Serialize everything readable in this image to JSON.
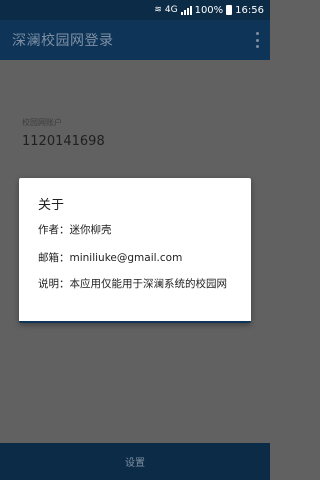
{
  "status_bar": {
    "network": "4G",
    "battery": "100%",
    "time": "16:56",
    "icons": [
      "wifi-icon",
      "signal-icon",
      "battery-icon"
    ]
  },
  "app_bar": {
    "title": "深澜校园网登录",
    "overflow_icon": "more-vert-icon"
  },
  "form": {
    "account_label": "校园网账户",
    "account_value": "1120141698"
  },
  "bottom": {
    "settings_label": "设置"
  },
  "dialog": {
    "title": "关于",
    "author": "作者：迷你柳壳",
    "email": "邮箱：miniliuke@gmail.com",
    "description": "说明：本应用仅能用于深澜系统的校园网"
  },
  "colors": {
    "primary_dark": "#0b2b46",
    "primary": "#0e3558",
    "scrim": "#616161",
    "dialog_bg": "#ffffff"
  }
}
